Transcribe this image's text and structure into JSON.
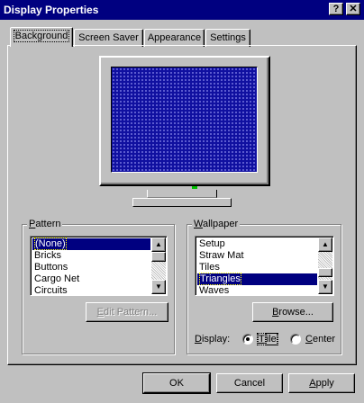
{
  "window": {
    "title": "Display Properties",
    "help_button": "?",
    "close_button": "✕"
  },
  "tabs": [
    {
      "label": "Background",
      "active": true
    },
    {
      "label": "Screen Saver",
      "active": false
    },
    {
      "label": "Appearance",
      "active": false
    },
    {
      "label": "Settings",
      "active": false
    }
  ],
  "pattern": {
    "group_label_access": "P",
    "group_label_rest": "attern",
    "items": [
      "(None)",
      "Bricks",
      "Buttons",
      "Cargo Net",
      "Circuits"
    ],
    "selected": "(None)",
    "edit_button_access": "E",
    "edit_button_rest": "dit Pattern..."
  },
  "wallpaper": {
    "group_label_access": "W",
    "group_label_rest": "allpaper",
    "items": [
      "Setup",
      "Straw Mat",
      "Tiles",
      "Triangles",
      "Waves"
    ],
    "selected": "Triangles",
    "browse_button_access": "B",
    "browse_button_rest": "rowse...",
    "display_label_access": "D",
    "display_label_rest": "isplay:",
    "options": [
      {
        "access": "T",
        "rest": "ile",
        "checked": true
      },
      {
        "access": "C",
        "rest": "enter",
        "checked": false
      }
    ]
  },
  "buttons": {
    "ok": "OK",
    "cancel": "Cancel",
    "apply_access": "A",
    "apply_rest": "pply"
  },
  "colors": {
    "title_bar": "#000080",
    "face": "#c0c0c0",
    "selection": "#000080",
    "desktop_preview": "#1010a0"
  }
}
